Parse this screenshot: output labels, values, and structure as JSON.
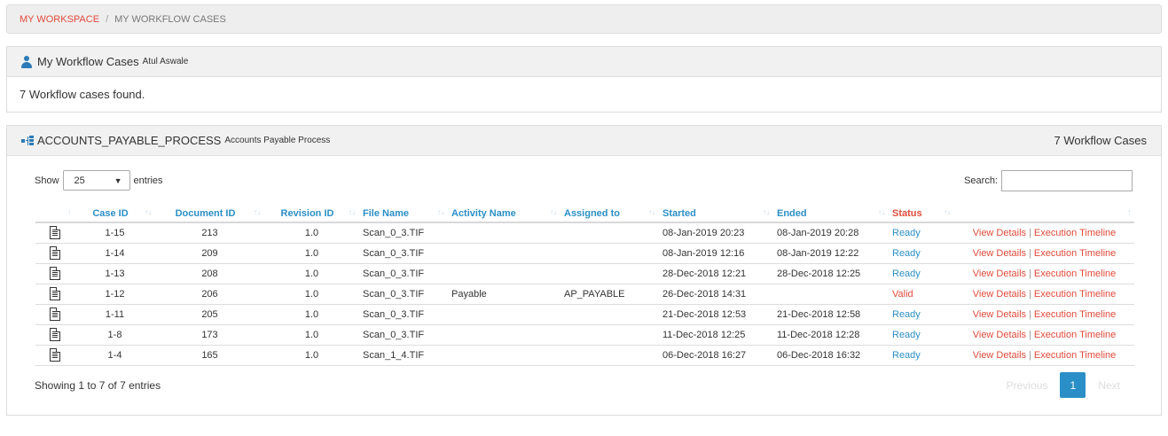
{
  "breadcrumb": {
    "link": "MY WORKSPACE",
    "separator": "/",
    "current": "MY WORKFLOW CASES"
  },
  "cases_panel": {
    "title": "My Workflow Cases",
    "user": "Atul Aswale",
    "icon": "user-icon",
    "message": "7 Workflow cases found."
  },
  "process_panel": {
    "title": "ACCOUNTS_PAYABLE_PROCESS",
    "subtitle": "Accounts Payable Process",
    "count_label": "7 Workflow Cases",
    "icon": "sitemap-icon",
    "show_label": "Show",
    "length_value": "25",
    "entries_label": "entries",
    "search_label": "Search:",
    "search_value": "",
    "info": "Showing 1 to 7 of 7 entries",
    "pagination": {
      "previous": "Previous",
      "current": "1",
      "next": "Next"
    }
  },
  "table": {
    "columns": [
      "",
      "Case ID",
      "Document ID",
      "Revision ID",
      "File Name",
      "Activity Name",
      "Assigned to",
      "Started",
      "Ended",
      "Status",
      ""
    ],
    "rows": [
      {
        "case_id": "1-15",
        "document_id": "213",
        "revision_id": "1.0",
        "file_name": "Scan_0_3.TIF",
        "activity": "",
        "assigned": "",
        "started": "08-Jan-2019 20:23",
        "ended": "08-Jan-2019 20:28",
        "status": "Ready",
        "view": "View Details",
        "sep": "|",
        "timeline": "Execution Timeline"
      },
      {
        "case_id": "1-14",
        "document_id": "209",
        "revision_id": "1.0",
        "file_name": "Scan_0_3.TIF",
        "activity": "",
        "assigned": "",
        "started": "08-Jan-2019 12:16",
        "ended": "08-Jan-2019 12:22",
        "status": "Ready",
        "view": "View Details",
        "sep": "|",
        "timeline": "Execution Timeline"
      },
      {
        "case_id": "1-13",
        "document_id": "208",
        "revision_id": "1.0",
        "file_name": "Scan_0_3.TIF",
        "activity": "",
        "assigned": "",
        "started": "28-Dec-2018 12:21",
        "ended": "28-Dec-2018 12:25",
        "status": "Ready",
        "view": "View Details",
        "sep": "|",
        "timeline": "Execution Timeline"
      },
      {
        "case_id": "1-12",
        "document_id": "206",
        "revision_id": "1.0",
        "file_name": "Scan_0_3.TIF",
        "activity": "Payable",
        "assigned": "AP_PAYABLE",
        "started": "26-Dec-2018 14:31",
        "ended": "",
        "status": "Valid",
        "view": "View Details",
        "sep": "|",
        "timeline": "Execution Timeline"
      },
      {
        "case_id": "1-11",
        "document_id": "205",
        "revision_id": "1.0",
        "file_name": "Scan_0_3.TIF",
        "activity": "",
        "assigned": "",
        "started": "21-Dec-2018 12:53",
        "ended": "21-Dec-2018 12:58",
        "status": "Ready",
        "view": "View Details",
        "sep": "|",
        "timeline": "Execution Timeline"
      },
      {
        "case_id": "1-8",
        "document_id": "173",
        "revision_id": "1.0",
        "file_name": "Scan_0_3.TIF",
        "activity": "",
        "assigned": "",
        "started": "11-Dec-2018 12:25",
        "ended": "11-Dec-2018 12:28",
        "status": "Ready",
        "view": "View Details",
        "sep": "|",
        "timeline": "Execution Timeline"
      },
      {
        "case_id": "1-4",
        "document_id": "165",
        "revision_id": "1.0",
        "file_name": "Scan_1_4.TIF",
        "activity": "",
        "assigned": "",
        "started": "06-Dec-2018 16:27",
        "ended": "06-Dec-2018 16:32",
        "status": "Ready",
        "view": "View Details",
        "sep": "|",
        "timeline": "Execution Timeline"
      }
    ]
  },
  "colors": {
    "accent": "#2b8fc7",
    "link_red": "#e14b3b",
    "header_bg": "#f1f1f1"
  }
}
